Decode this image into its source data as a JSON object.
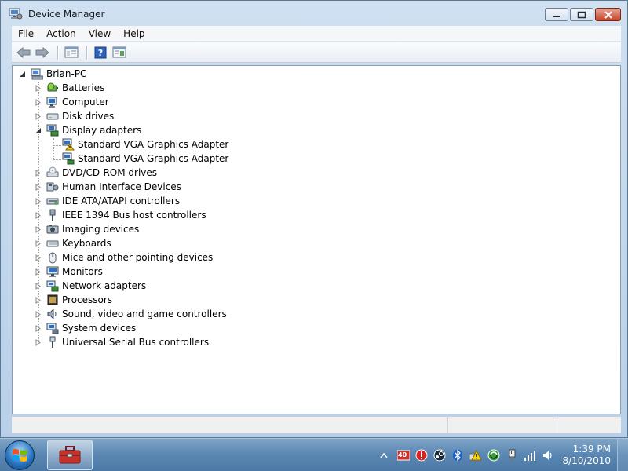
{
  "window": {
    "title": "Device Manager"
  },
  "menu": {
    "items": [
      "File",
      "Action",
      "View",
      "Help"
    ]
  },
  "tree": {
    "root": "Brian-PC",
    "items": [
      {
        "label": "Batteries",
        "icon": "battery-icon",
        "expanded": false
      },
      {
        "label": "Computer",
        "icon": "computer-icon",
        "expanded": false
      },
      {
        "label": "Disk drives",
        "icon": "disk-drive-icon",
        "expanded": false
      },
      {
        "label": "Display adapters",
        "icon": "display-adapter-icon",
        "expanded": true
      },
      {
        "label": "Standard VGA Graphics Adapter",
        "icon": "vga-adapter-warning-icon",
        "child": true
      },
      {
        "label": "Standard VGA Graphics Adapter",
        "icon": "vga-adapter-icon",
        "child": true
      },
      {
        "label": "DVD/CD-ROM drives",
        "icon": "dvd-drive-icon",
        "expanded": false
      },
      {
        "label": "Human Interface Devices",
        "icon": "hid-icon",
        "expanded": false
      },
      {
        "label": "IDE ATA/ATAPI controllers",
        "icon": "ide-controller-icon",
        "expanded": false
      },
      {
        "label": "IEEE 1394 Bus host controllers",
        "icon": "ieee1394-icon",
        "expanded": false
      },
      {
        "label": "Imaging devices",
        "icon": "camera-icon",
        "expanded": false
      },
      {
        "label": "Keyboards",
        "icon": "keyboard-icon",
        "expanded": false
      },
      {
        "label": "Mice and other pointing devices",
        "icon": "mouse-icon",
        "expanded": false
      },
      {
        "label": "Monitors",
        "icon": "monitor-icon",
        "expanded": false
      },
      {
        "label": "Network adapters",
        "icon": "network-adapter-icon",
        "expanded": false
      },
      {
        "label": "Processors",
        "icon": "processor-icon",
        "expanded": false
      },
      {
        "label": "Sound, video and game controllers",
        "icon": "speaker-icon",
        "expanded": false
      },
      {
        "label": "System devices",
        "icon": "system-device-icon",
        "expanded": false
      },
      {
        "label": "Universal Serial Bus controllers",
        "icon": "usb-icon",
        "expanded": false
      }
    ]
  },
  "taskbar": {
    "time": "1:39 PM",
    "date": "8/10/2010",
    "tray_badge": "40"
  }
}
